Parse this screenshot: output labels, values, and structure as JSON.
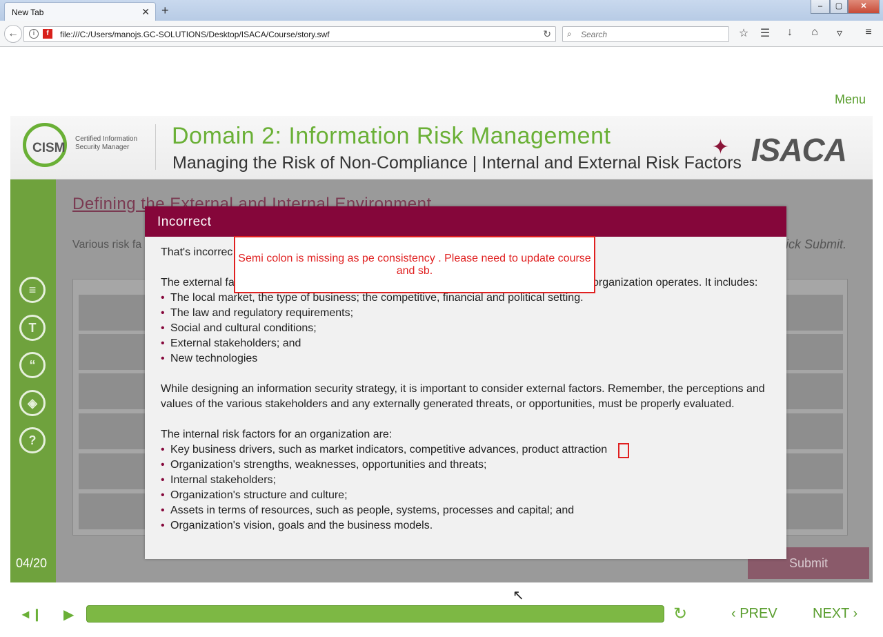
{
  "browser": {
    "tab_title": "New Tab",
    "tab_close": "✕",
    "new_tab": "+",
    "url": "file:///C:/Users/manojs.GC-SOLUTIONS/Desktop/ISACA/Course/story.swf",
    "search_placeholder": "Search",
    "window_controls": [
      "–",
      "▢",
      "✕"
    ]
  },
  "course": {
    "menu_label": "Menu",
    "logo_text": "CISM",
    "logo_subtitle_1": "Certified Information",
    "logo_subtitle_2": "Security Manager",
    "domain_title": "Domain 2: Information Risk Management",
    "domain_subtitle": "Managing the Risk of Non-Compliance | Internal and External Risk Factors",
    "brand": "ISACA",
    "page_counter": "04/20"
  },
  "slide": {
    "title": "Defining the External and Internal Environment",
    "intro": "Various risk fa",
    "intro_right": "ick Submit.",
    "submit_label": "Submit"
  },
  "modal": {
    "title": "Incorrect",
    "lead": "That's incorrec",
    "external_intro_start": "The external fa",
    "external_intro_end": "organization operates. It includes:",
    "external_items": [
      "The local market, the type of business; the competitive, financial and political setting.",
      "The law and regulatory requirements;",
      "Social and cultural conditions;",
      "External stakeholders; and",
      "New technologies"
    ],
    "paragraph": "While designing an information security strategy, it is important to consider external factors. Remember, the perceptions and values of the various stakeholders and any externally generated threats, or opportunities, must be properly evaluated.",
    "internal_intro": "The internal risk factors for an organization are:",
    "internal_items": [
      "Key business drivers, such as market indicators, competitive advances, product attraction",
      "Organization's strengths, weaknesses, opportunities and threats;",
      "Internal stakeholders;",
      "Organization's structure and culture;",
      "Assets in terms of resources, such as people, systems, processes and capital; and",
      "Organization's vision, goals and the business models."
    ]
  },
  "annotation": {
    "text": "Semi colon is missing as pe consistency . Please need to update course and sb."
  },
  "player": {
    "prev_label": "PREV",
    "next_label": "NEXT",
    "progress": 1.0
  }
}
